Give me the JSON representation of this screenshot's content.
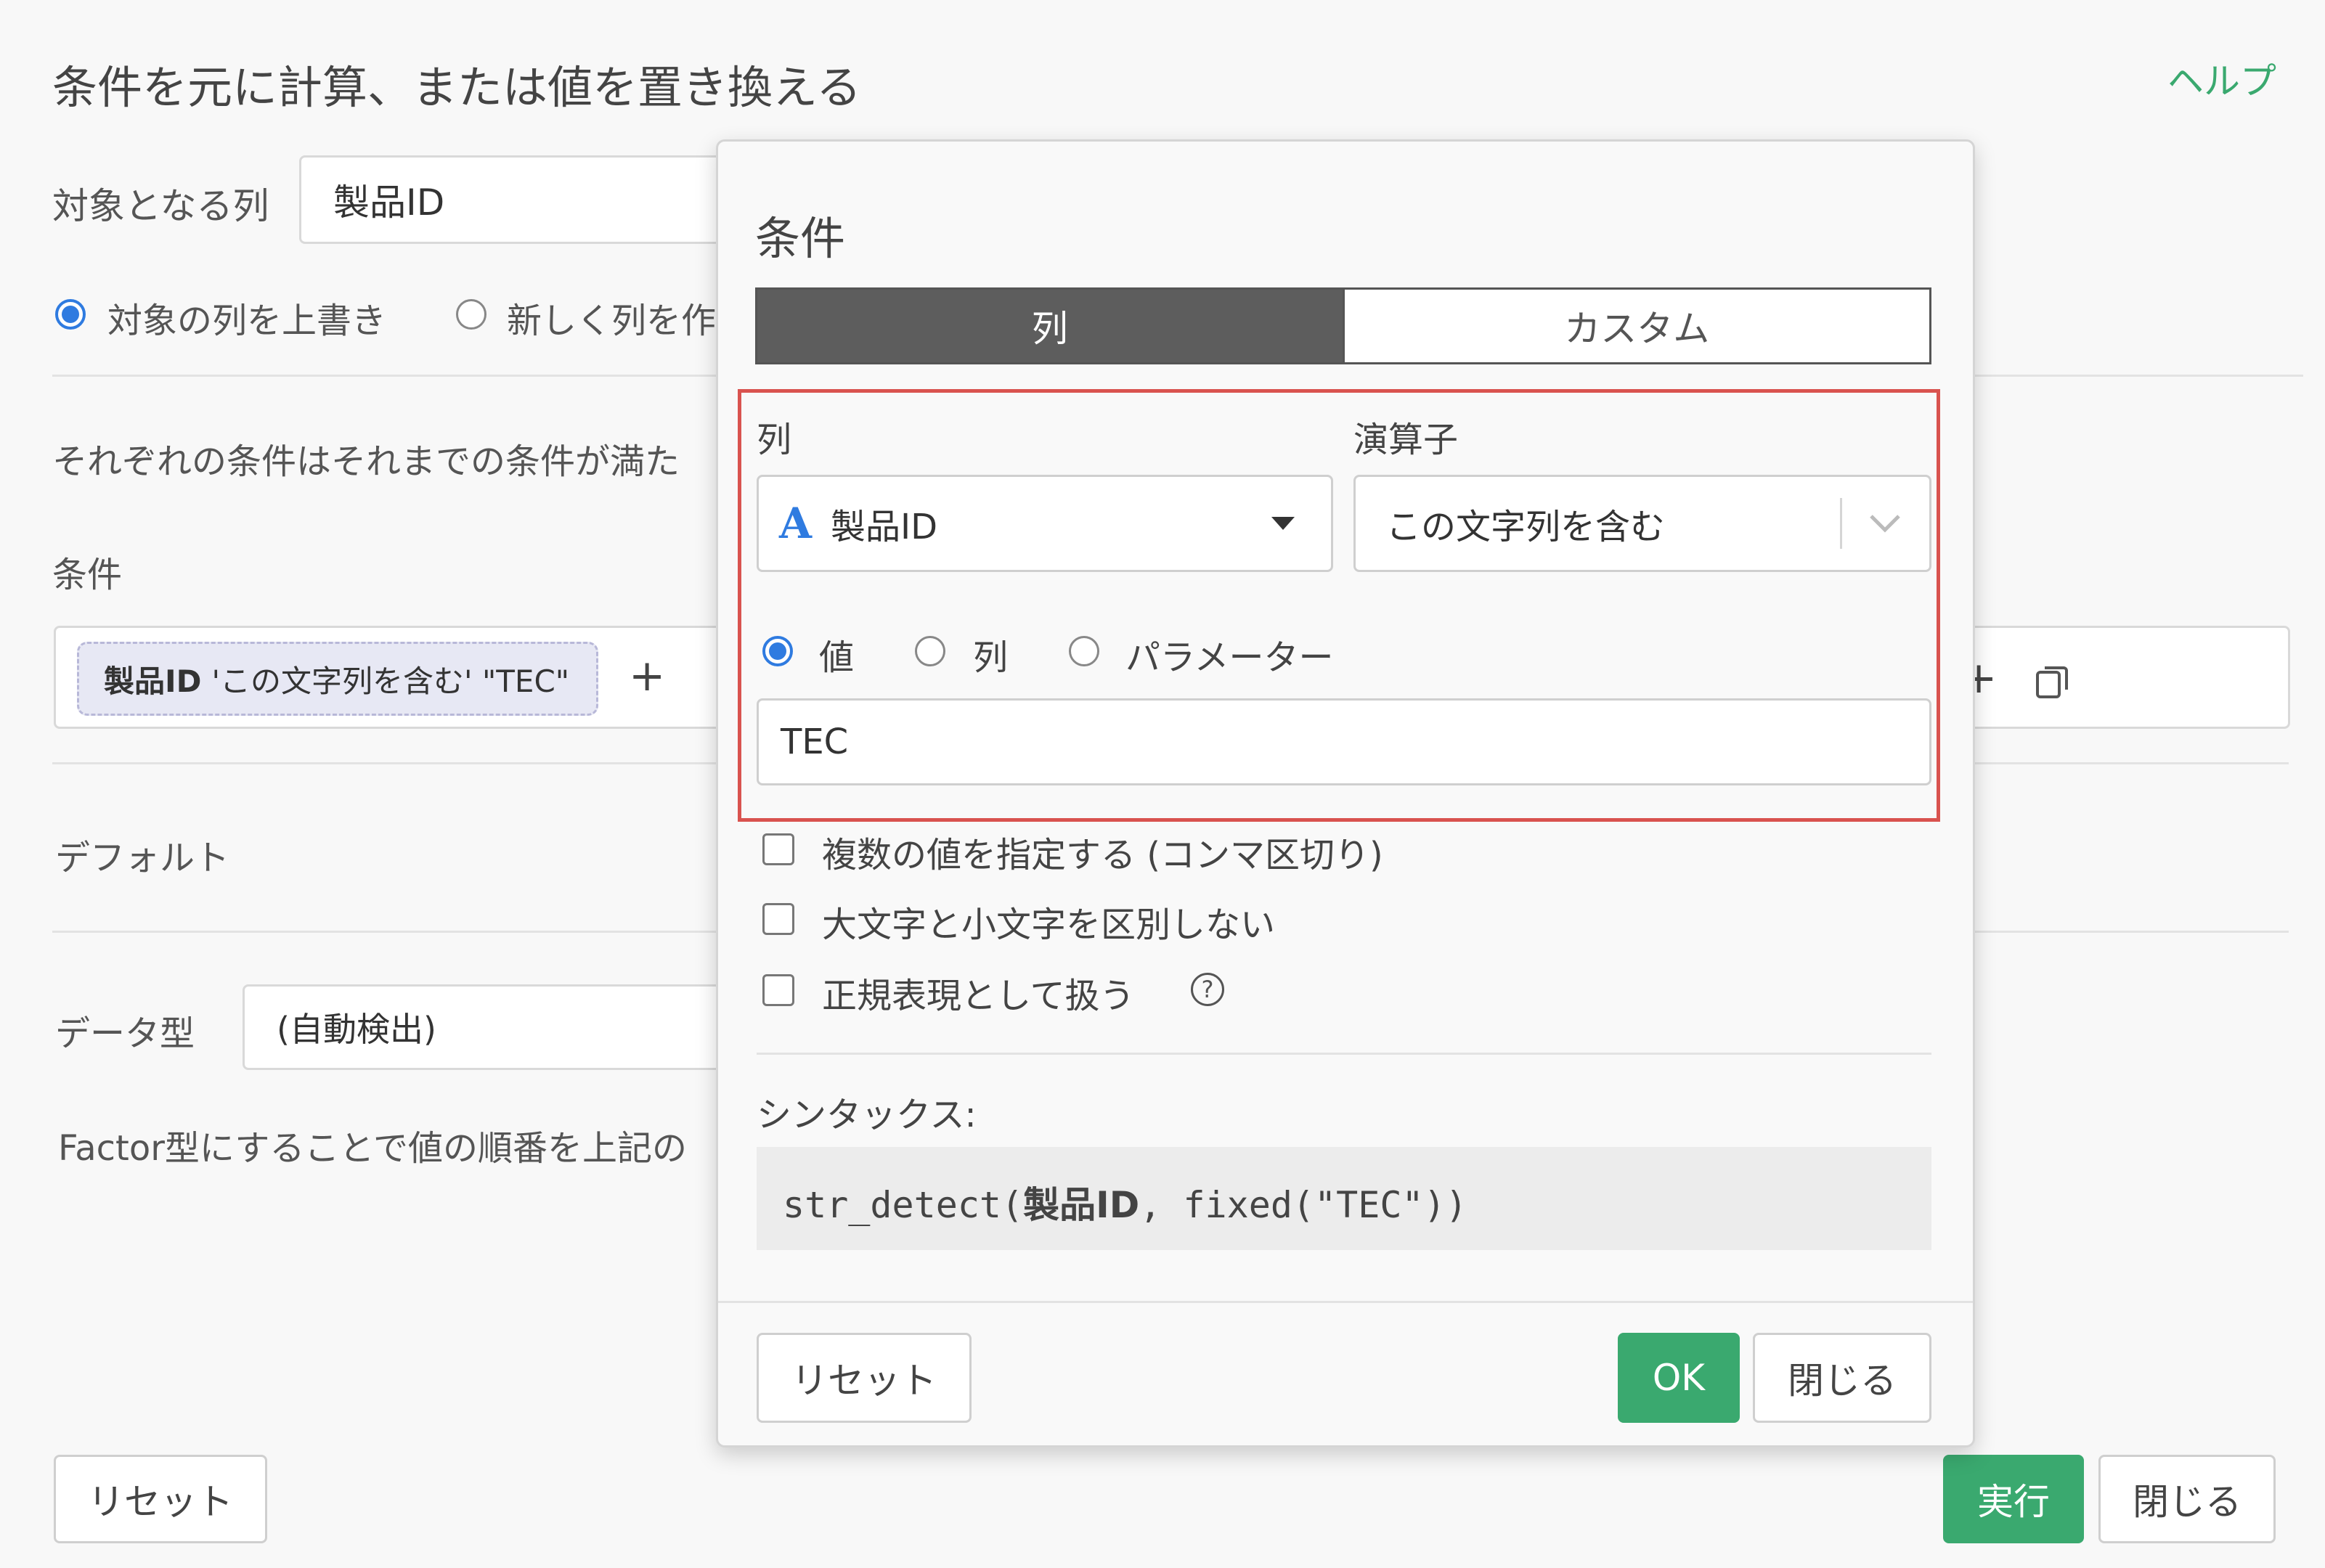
{
  "background": {
    "title": "条件を元に計算、または値を置き換える",
    "help": "ヘルプ",
    "target_column_label": "対象となる列",
    "target_column_value": "製品ID",
    "overwrite_option": "対象の列を上書き",
    "new_column_option": "新しく列を作",
    "description": "それぞれの条件はそれまでの条件が満た",
    "conditions_label": "条件",
    "condition_chip": {
      "column": "製品ID",
      "text": "'この文字列を含む' \"TEC\""
    },
    "add_symbol": "+",
    "default_label": "デフォルト",
    "datatype_label": "データ型",
    "datatype_value": "(自動検出)",
    "factor_note": "Factor型にすることで値の順番を上記の",
    "reset_button": "リセット",
    "run_button": "実行",
    "close_button": "閉じる"
  },
  "modal": {
    "title": "条件",
    "tabs": [
      {
        "label": "列"
      },
      {
        "label": "カスタム"
      }
    ],
    "column_label": "列",
    "column_type_glyph": "A",
    "column_value": "製品ID",
    "operator_label": "演算子",
    "operator_value": "この文字列を含む",
    "value_type_options": [
      "値",
      "列",
      "パラメーター"
    ],
    "value_input": "TEC",
    "options": [
      "複数の値を指定する (コンマ区切り)",
      "大文字と小文字を区別しない",
      "正規表現として扱う"
    ],
    "help_glyph": "?",
    "syntax_label": "シンタックス:",
    "syntax": {
      "prefix": "str_detect(",
      "column": "製品ID",
      "suffix": ", fixed(\"TEC\"))"
    },
    "reset_button": "リセット",
    "ok_button": "OK",
    "close_button": "閉じる"
  },
  "colors": {
    "accent": "#3aa96f",
    "radio": "#2f7be0",
    "highlight": "#d9534f",
    "tab_active": "#5d5d5d"
  }
}
